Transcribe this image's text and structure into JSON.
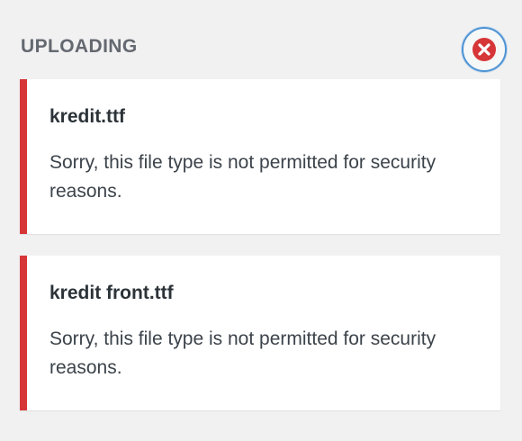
{
  "header": {
    "title": "UPLOADING"
  },
  "dismiss": {
    "icon": "close-circle-icon",
    "color": "#d63638"
  },
  "errors": [
    {
      "filename": "kredit.ttf",
      "message": "Sorry, this file type is not permitted for security reasons."
    },
    {
      "filename": "kredit front.ttf",
      "message": "Sorry, this file type is not permitted for security reasons."
    }
  ],
  "colors": {
    "error_accent": "#d63638",
    "focus_ring": "#4f94d4"
  }
}
